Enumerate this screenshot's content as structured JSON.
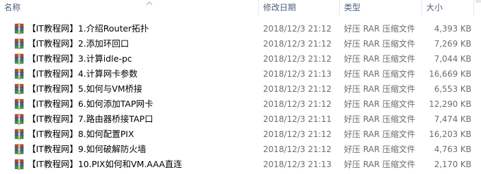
{
  "columns": {
    "name": "名称",
    "date": "修改日期",
    "type": "类型",
    "size": "大小"
  },
  "files": [
    {
      "name": "【IT教程网】1.介绍Router拓扑",
      "date": "2018/12/3 21:12",
      "type": "好压 RAR 压缩文件",
      "size": "4,393 KB",
      "icon": "rar-archive-icon"
    },
    {
      "name": "【IT教程网】2.添加环回口",
      "date": "2018/12/3 21:12",
      "type": "好压 RAR 压缩文件",
      "size": "7,269 KB",
      "icon": "rar-archive-icon"
    },
    {
      "name": "【IT教程网】3.计算idle-pc",
      "date": "2018/12/3 21:12",
      "type": "好压 RAR 压缩文件",
      "size": "7,044 KB",
      "icon": "rar-archive-icon"
    },
    {
      "name": "【IT教程网】4.计算网卡参数",
      "date": "2018/12/3 21:13",
      "type": "好压 RAR 压缩文件",
      "size": "16,669 KB",
      "icon": "rar-archive-icon"
    },
    {
      "name": "【IT教程网】5.如何与VM桥接",
      "date": "2018/12/3 21:12",
      "type": "好压 RAR 压缩文件",
      "size": "6,553 KB",
      "icon": "rar-archive-icon"
    },
    {
      "name": "【IT教程网】6.如何添加TAP网卡",
      "date": "2018/12/3 21:12",
      "type": "好压 RAR 压缩文件",
      "size": "12,290 KB",
      "icon": "rar-archive-icon"
    },
    {
      "name": "【IT教程网】7.路由器桥接TAP口",
      "date": "2018/12/3 21:11",
      "type": "好压 RAR 压缩文件",
      "size": "7,474 KB",
      "icon": "rar-archive-icon"
    },
    {
      "name": "【IT教程网】8.如何配置PIX",
      "date": "2018/12/3 21:12",
      "type": "好压 RAR 压缩文件",
      "size": "16,203 KB",
      "icon": "rar-archive-icon"
    },
    {
      "name": "【IT教程网】9.如何破解防火墙",
      "date": "2018/12/3 21:12",
      "type": "好压 RAR 压缩文件",
      "size": "4,763 KB",
      "icon": "rar-archive-icon"
    },
    {
      "name": "【IT教程网】10.PIX如何和VM.AAA直连",
      "date": "2018/12/3 21:13",
      "type": "好压 RAR 压缩文件",
      "size": "2,170 KB",
      "icon": "rar-archive-icon"
    }
  ],
  "colors": {
    "header_text": "#4c607a",
    "name_text": "#000000",
    "detail_text": "#6d6d6d",
    "icon_red": "#c8412b",
    "icon_blue": "#3b63b8",
    "icon_green": "#2f9a48"
  }
}
